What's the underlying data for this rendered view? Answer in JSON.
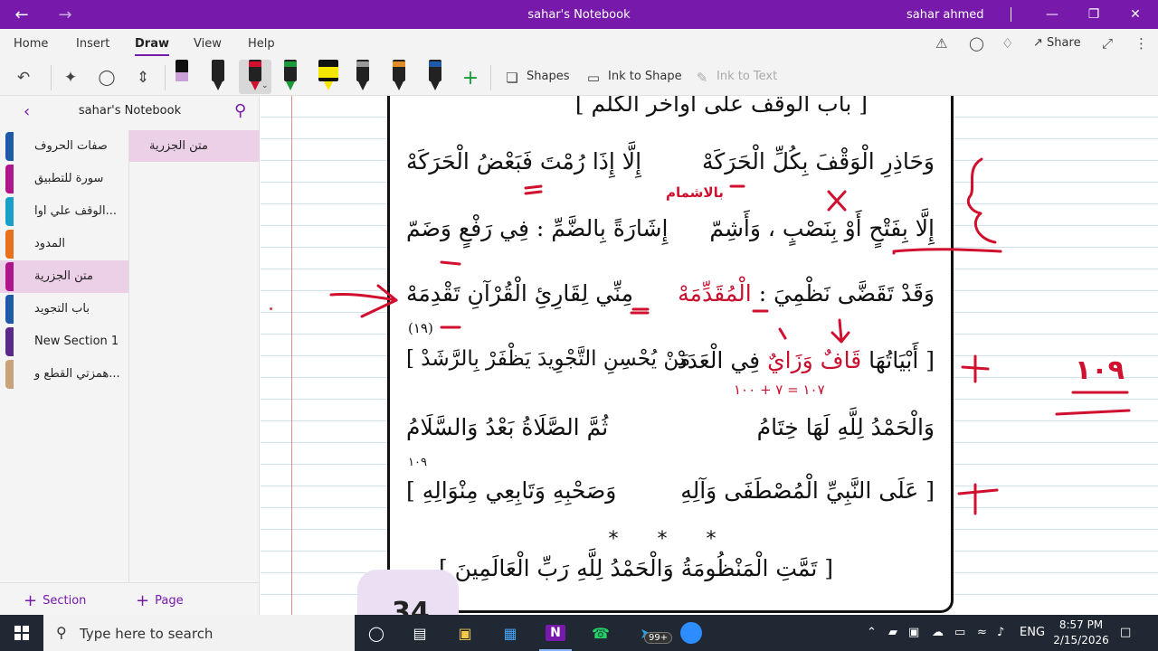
{
  "window": {
    "title": "sahar's Notebook",
    "user": "sahar ahmed"
  },
  "ribbon": {
    "tabs": [
      "Home",
      "Insert",
      "Draw",
      "View",
      "Help"
    ],
    "active_tab": "Draw",
    "share_label": "Share"
  },
  "toolbar": {
    "shapes_label": "Shapes",
    "ink_to_shape_label": "Ink to Shape",
    "ink_to_text_label": "Ink to Text",
    "pens": [
      {
        "color": "#c9a1d6",
        "name": "highlighter-purple"
      },
      {
        "color": "#111111",
        "name": "pen-black"
      },
      {
        "color": "#d0102e",
        "name": "pen-red"
      },
      {
        "color": "#1a9a3a",
        "name": "pen-green"
      },
      {
        "color": "#f5e600",
        "name": "highlighter-yellow"
      },
      {
        "color": "#9a9a9a",
        "name": "pen-galaxy"
      },
      {
        "color": "#e08a2a",
        "name": "pen-rainbow"
      },
      {
        "color": "#1e5aa8",
        "name": "pen-blue"
      }
    ]
  },
  "sidebar": {
    "notebook_name": "sahar's Notebook",
    "sections": [
      {
        "label": "صفات الحروف",
        "color": "#1e5aa8"
      },
      {
        "label": "سورة للتطبيق",
        "color": "#b0168c"
      },
      {
        "label": "الوقف علي اوا...",
        "color": "#1aa0c8"
      },
      {
        "label": "المدود",
        "color": "#e8701a"
      },
      {
        "label": "متن الجزرية",
        "color": "#b0168c"
      },
      {
        "label": "باب التجويد",
        "color": "#1e5aa8"
      },
      {
        "label": "New Section 1",
        "color": "#5a2a8a"
      },
      {
        "label": "همزتي القطع و...",
        "color": "#c9a27a"
      }
    ],
    "active_section": 4,
    "pages": [
      {
        "label": "متن الجزرية"
      }
    ],
    "add_section_label": "Section",
    "add_page_label": "Page"
  },
  "document": {
    "heading": "[ باب الوقف على أواخر الكلم ]",
    "lines": [
      {
        "right": "وَحَاذِرِ الْوَقْفَ بِكُلِّ الْحَرَكَهْ",
        "left": "إِلَّا إِذَا رُمْتَ فَبَعْضُ الْحَرَكَهْ"
      },
      {
        "right": "إِلَّا بِفَتْحٍ أَوْ بِنَصْبٍ ، وَأَشِمّ",
        "left": "إِشَارَةً بِالضَّمِّ : فِي رَفْعٍ وَضَمّ"
      },
      {
        "right": "وَقَدْ تَقَضَّى نَظْمِيَ :",
        "right_red": "الْمُقَدِّمَهْ",
        "left": "مِنِّي لِقَارِئِ الْقُرْآنِ تَقْدِمَهْ"
      },
      {
        "right": "[ أَبْيَاتُهَا",
        "right_red": "قَافٌ وَزَايٌ",
        "right_end": "فِي الْعَدَدْ",
        "left": "مَنْ يُحْسِنِ التَّجْوِيدَ يَظْفَرْ بِالرَّشَدْ ]"
      },
      {
        "right": "وَالْحَمْدُ لِلَّهِ لَهَا خِتَامُ",
        "left": "ثُمَّ الصَّلَاةُ بَعْدُ وَالسَّلَامُ"
      },
      {
        "right": "[ عَلَى النَّبِيِّ الْمُصْطَفَى وَآلِهِ",
        "left": "وَصَحْبِهِ وَتَابِعِي مِنْوَالِهِ ]"
      }
    ],
    "verse_number_1": "(١٩)",
    "verse_number_2": "١٠٩",
    "sum_annotation": "١٠٧ = ٧ + ١٠٠",
    "stars": "* * *",
    "closing": "[ تَمَّتِ الْمَنْظُومَةُ وَالْحَمْدُ لِلَّهِ رَبِّ الْعَالَمِينَ ]",
    "handwritten_note": "بالاشمام",
    "handwritten_number": "١٠٩",
    "thumbnail_text": "34"
  },
  "taskbar": {
    "search_placeholder": "Type here to search",
    "notification_badge": "99+",
    "language": "ENG",
    "time": "8:57 PM",
    "date": "2/15/2026"
  }
}
